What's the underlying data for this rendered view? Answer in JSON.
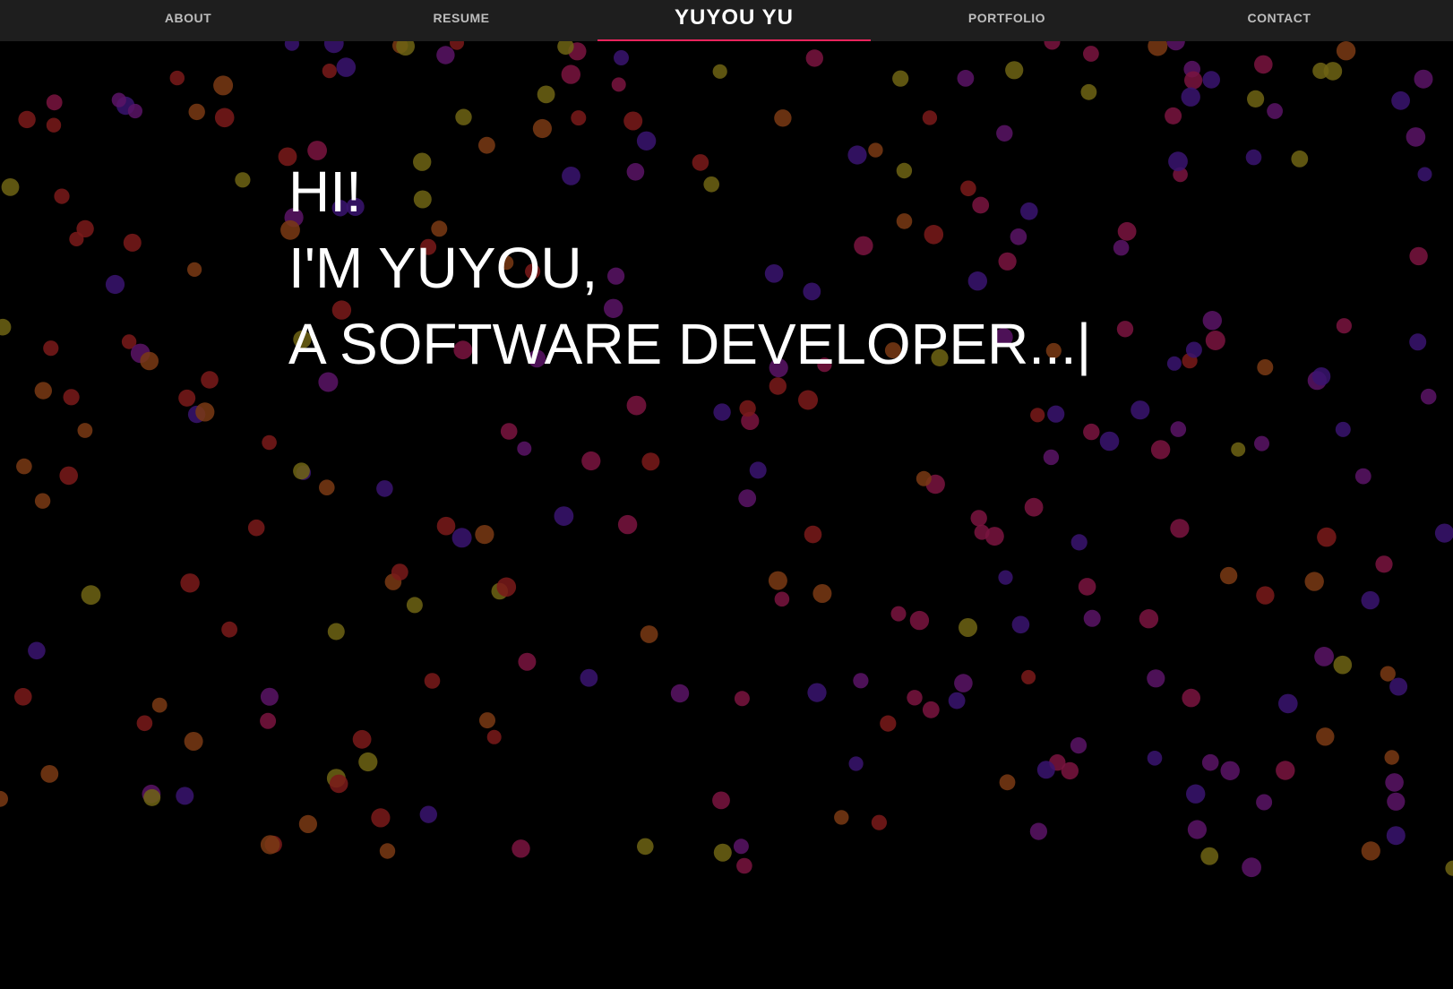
{
  "nav": {
    "about": "ABOUT",
    "resume": "RESUME",
    "brand": "YUYOU YU",
    "portfolio": "PORTFOLIO",
    "contact": "CONTACT"
  },
  "hero": {
    "line1": "HI!",
    "line2": "I'M YUYOU,",
    "line3": "A SOFTWARE DEVELOPER...",
    "cursor": "|"
  },
  "colors": {
    "background": "#000000",
    "nav_background": "#1e1e1e",
    "nav_text": "#bdbdbd",
    "brand_text": "#ffffff",
    "accent": "#e8245c",
    "hero_text": "#ffffff",
    "particles": [
      "#7a1a1a",
      "#7a3a14",
      "#6e6414",
      "#5a1466",
      "#3a1470",
      "#7a1440"
    ]
  }
}
